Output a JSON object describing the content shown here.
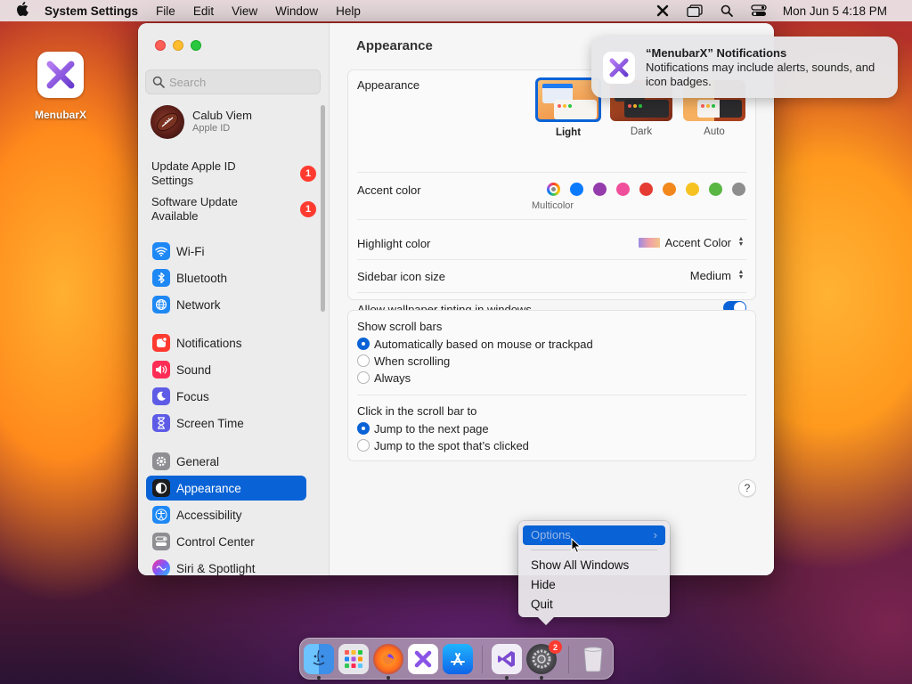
{
  "menubar": {
    "app_name": "System Settings",
    "menus": [
      "File",
      "Edit",
      "View",
      "Window",
      "Help"
    ],
    "clock": "Mon Jun 5  4:18 PM",
    "status_icons": [
      "menubarx-icon",
      "window-icon",
      "search-icon",
      "control-center-icon"
    ]
  },
  "desktop": {
    "app_label": "MenubarX"
  },
  "sidebar": {
    "search_placeholder": "Search",
    "profile": {
      "name": "Calub Viem",
      "subtitle": "Apple ID"
    },
    "updates": [
      {
        "line1": "Update Apple ID",
        "line2": "Settings",
        "badge": "1"
      },
      {
        "line1": "Software Update",
        "line2": "Available",
        "badge": "1"
      }
    ],
    "items": [
      {
        "label": "Wi-Fi",
        "icon": "wifi-icon",
        "color": "#1e88f5"
      },
      {
        "label": "Bluetooth",
        "icon": "bluetooth-icon",
        "color": "#1e88f5"
      },
      {
        "label": "Network",
        "icon": "globe-icon",
        "color": "#1e88f5"
      },
      {
        "label": "Notifications",
        "icon": "bell-icon",
        "color": "#ff3b30"
      },
      {
        "label": "Sound",
        "icon": "speaker-icon",
        "color": "#ff2d55"
      },
      {
        "label": "Focus",
        "icon": "moon-icon",
        "color": "#5e5ce6"
      },
      {
        "label": "Screen Time",
        "icon": "hourglass-icon",
        "color": "#5e5ce6"
      },
      {
        "label": "General",
        "icon": "gear-icon",
        "color": "#8e8e93"
      },
      {
        "label": "Appearance",
        "icon": "appearance-icon",
        "color": "#1c1c1e"
      },
      {
        "label": "Accessibility",
        "icon": "accessibility-icon",
        "color": "#1e88f5"
      },
      {
        "label": "Control Center",
        "icon": "control-center-icon",
        "color": "#8e8e93"
      },
      {
        "label": "Siri & Spotlight",
        "icon": "siri-icon",
        "color": "#b84cd8"
      }
    ],
    "selected": "Appearance"
  },
  "main": {
    "title": "Appearance",
    "appearance": {
      "label": "Appearance",
      "options": [
        "Light",
        "Dark",
        "Auto"
      ],
      "selected": "Light"
    },
    "accent": {
      "label": "Accent color",
      "sublabel": "Multicolor",
      "colors": [
        "multicolor",
        "#0a7aff",
        "#953cad",
        "#f0509b",
        "#e53b32",
        "#f2871c",
        "#f6c221",
        "#5ab643",
        "#8e8e8e"
      ]
    },
    "highlight": {
      "label": "Highlight color",
      "value": "Accent Color"
    },
    "sidebar_icon": {
      "label": "Sidebar icon size",
      "value": "Medium"
    },
    "tinting": {
      "label": "Allow wallpaper tinting in windows",
      "enabled": true
    },
    "scroll_bars": {
      "label": "Show scroll bars",
      "options": [
        "Automatically based on mouse or trackpad",
        "When scrolling",
        "Always"
      ],
      "selected": 0
    },
    "click_scroll": {
      "label": "Click in the scroll bar to",
      "options": [
        "Jump to the next page",
        "Jump to the spot that’s clicked"
      ],
      "selected": 0
    },
    "help": "?"
  },
  "notification": {
    "title": "“MenubarX” Notifications",
    "body": "Notifications may include alerts, sounds, and icon badges."
  },
  "context_menu": {
    "options": "Options",
    "items": [
      "Show All Windows",
      "Hide",
      "Quit"
    ]
  },
  "dock": {
    "apps": [
      "finder-icon",
      "launchpad-icon",
      "firefox-icon",
      "menubarx-icon",
      "app-store-icon",
      "visual-studio-icon",
      "system-settings-icon",
      "trash-icon"
    ],
    "settings_badge": "2"
  }
}
